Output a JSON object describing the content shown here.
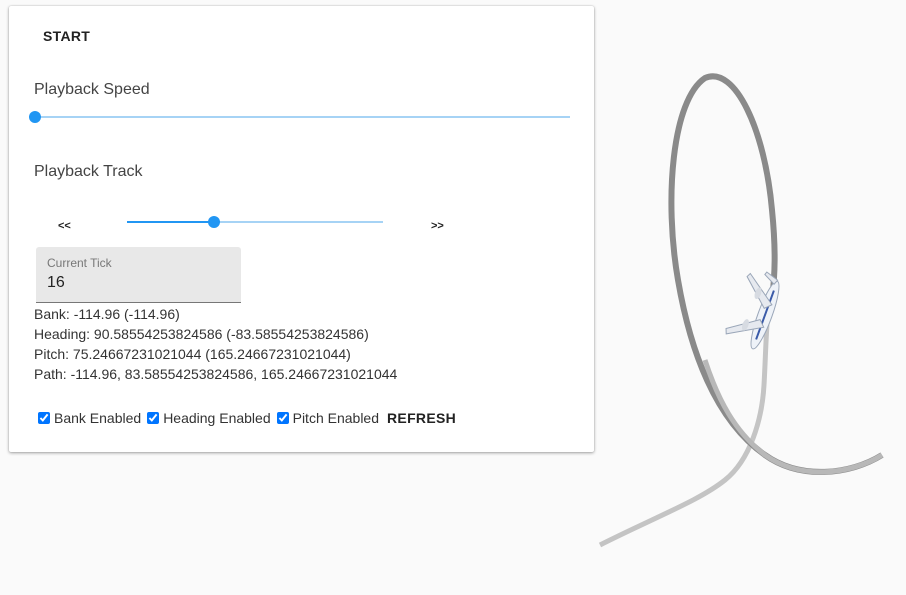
{
  "controls": {
    "start_label": "START",
    "speed_label": "Playback Speed",
    "track_label": "Playback Track",
    "speed_value": 0.0,
    "track_value": 0.34,
    "prev_label": "<<",
    "next_label": ">>",
    "tick_field_label": "Current Tick",
    "tick_value": "16"
  },
  "readouts": {
    "bank": "Bank: -114.96 (-114.96)",
    "heading": "Heading: 90.58554253824586 (-83.58554253824586)",
    "pitch": "Pitch: 75.24667231021044 (165.24667231021044)",
    "path": "Path: -114.96, 83.58554253824586, 165.24667231021044"
  },
  "toggles": {
    "bank_label": "Bank Enabled",
    "bank_checked": true,
    "heading_label": "Heading Enabled",
    "heading_checked": true,
    "pitch_label": "Pitch Enabled",
    "pitch_checked": true,
    "refresh_label": "REFRESH"
  },
  "colors": {
    "accent": "#2196f3",
    "accent_light": "#a6d3f5",
    "track_dark": "#777777",
    "track_light": "#c2c2c2"
  },
  "icons": {
    "aircraft": "airplane-icon"
  }
}
